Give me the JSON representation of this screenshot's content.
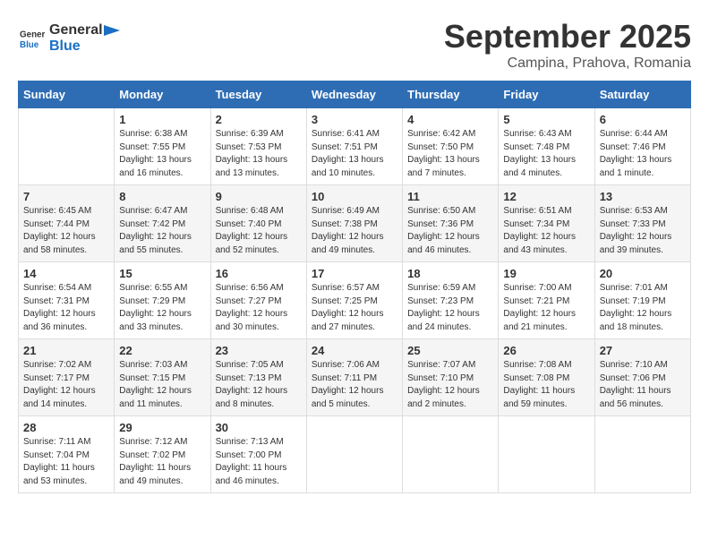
{
  "header": {
    "logo_general": "General",
    "logo_blue": "Blue",
    "month_title": "September 2025",
    "subtitle": "Campina, Prahova, Romania"
  },
  "weekdays": [
    "Sunday",
    "Monday",
    "Tuesday",
    "Wednesday",
    "Thursday",
    "Friday",
    "Saturday"
  ],
  "weeks": [
    [
      {
        "day": "",
        "sunrise": "",
        "sunset": "",
        "daylight": ""
      },
      {
        "day": "1",
        "sunrise": "Sunrise: 6:38 AM",
        "sunset": "Sunset: 7:55 PM",
        "daylight": "Daylight: 13 hours and 16 minutes."
      },
      {
        "day": "2",
        "sunrise": "Sunrise: 6:39 AM",
        "sunset": "Sunset: 7:53 PM",
        "daylight": "Daylight: 13 hours and 13 minutes."
      },
      {
        "day": "3",
        "sunrise": "Sunrise: 6:41 AM",
        "sunset": "Sunset: 7:51 PM",
        "daylight": "Daylight: 13 hours and 10 minutes."
      },
      {
        "day": "4",
        "sunrise": "Sunrise: 6:42 AM",
        "sunset": "Sunset: 7:50 PM",
        "daylight": "Daylight: 13 hours and 7 minutes."
      },
      {
        "day": "5",
        "sunrise": "Sunrise: 6:43 AM",
        "sunset": "Sunset: 7:48 PM",
        "daylight": "Daylight: 13 hours and 4 minutes."
      },
      {
        "day": "6",
        "sunrise": "Sunrise: 6:44 AM",
        "sunset": "Sunset: 7:46 PM",
        "daylight": "Daylight: 13 hours and 1 minute."
      }
    ],
    [
      {
        "day": "7",
        "sunrise": "Sunrise: 6:45 AM",
        "sunset": "Sunset: 7:44 PM",
        "daylight": "Daylight: 12 hours and 58 minutes."
      },
      {
        "day": "8",
        "sunrise": "Sunrise: 6:47 AM",
        "sunset": "Sunset: 7:42 PM",
        "daylight": "Daylight: 12 hours and 55 minutes."
      },
      {
        "day": "9",
        "sunrise": "Sunrise: 6:48 AM",
        "sunset": "Sunset: 7:40 PM",
        "daylight": "Daylight: 12 hours and 52 minutes."
      },
      {
        "day": "10",
        "sunrise": "Sunrise: 6:49 AM",
        "sunset": "Sunset: 7:38 PM",
        "daylight": "Daylight: 12 hours and 49 minutes."
      },
      {
        "day": "11",
        "sunrise": "Sunrise: 6:50 AM",
        "sunset": "Sunset: 7:36 PM",
        "daylight": "Daylight: 12 hours and 46 minutes."
      },
      {
        "day": "12",
        "sunrise": "Sunrise: 6:51 AM",
        "sunset": "Sunset: 7:34 PM",
        "daylight": "Daylight: 12 hours and 43 minutes."
      },
      {
        "day": "13",
        "sunrise": "Sunrise: 6:53 AM",
        "sunset": "Sunset: 7:33 PM",
        "daylight": "Daylight: 12 hours and 39 minutes."
      }
    ],
    [
      {
        "day": "14",
        "sunrise": "Sunrise: 6:54 AM",
        "sunset": "Sunset: 7:31 PM",
        "daylight": "Daylight: 12 hours and 36 minutes."
      },
      {
        "day": "15",
        "sunrise": "Sunrise: 6:55 AM",
        "sunset": "Sunset: 7:29 PM",
        "daylight": "Daylight: 12 hours and 33 minutes."
      },
      {
        "day": "16",
        "sunrise": "Sunrise: 6:56 AM",
        "sunset": "Sunset: 7:27 PM",
        "daylight": "Daylight: 12 hours and 30 minutes."
      },
      {
        "day": "17",
        "sunrise": "Sunrise: 6:57 AM",
        "sunset": "Sunset: 7:25 PM",
        "daylight": "Daylight: 12 hours and 27 minutes."
      },
      {
        "day": "18",
        "sunrise": "Sunrise: 6:59 AM",
        "sunset": "Sunset: 7:23 PM",
        "daylight": "Daylight: 12 hours and 24 minutes."
      },
      {
        "day": "19",
        "sunrise": "Sunrise: 7:00 AM",
        "sunset": "Sunset: 7:21 PM",
        "daylight": "Daylight: 12 hours and 21 minutes."
      },
      {
        "day": "20",
        "sunrise": "Sunrise: 7:01 AM",
        "sunset": "Sunset: 7:19 PM",
        "daylight": "Daylight: 12 hours and 18 minutes."
      }
    ],
    [
      {
        "day": "21",
        "sunrise": "Sunrise: 7:02 AM",
        "sunset": "Sunset: 7:17 PM",
        "daylight": "Daylight: 12 hours and 14 minutes."
      },
      {
        "day": "22",
        "sunrise": "Sunrise: 7:03 AM",
        "sunset": "Sunset: 7:15 PM",
        "daylight": "Daylight: 12 hours and 11 minutes."
      },
      {
        "day": "23",
        "sunrise": "Sunrise: 7:05 AM",
        "sunset": "Sunset: 7:13 PM",
        "daylight": "Daylight: 12 hours and 8 minutes."
      },
      {
        "day": "24",
        "sunrise": "Sunrise: 7:06 AM",
        "sunset": "Sunset: 7:11 PM",
        "daylight": "Daylight: 12 hours and 5 minutes."
      },
      {
        "day": "25",
        "sunrise": "Sunrise: 7:07 AM",
        "sunset": "Sunset: 7:10 PM",
        "daylight": "Daylight: 12 hours and 2 minutes."
      },
      {
        "day": "26",
        "sunrise": "Sunrise: 7:08 AM",
        "sunset": "Sunset: 7:08 PM",
        "daylight": "Daylight: 11 hours and 59 minutes."
      },
      {
        "day": "27",
        "sunrise": "Sunrise: 7:10 AM",
        "sunset": "Sunset: 7:06 PM",
        "daylight": "Daylight: 11 hours and 56 minutes."
      }
    ],
    [
      {
        "day": "28",
        "sunrise": "Sunrise: 7:11 AM",
        "sunset": "Sunset: 7:04 PM",
        "daylight": "Daylight: 11 hours and 53 minutes."
      },
      {
        "day": "29",
        "sunrise": "Sunrise: 7:12 AM",
        "sunset": "Sunset: 7:02 PM",
        "daylight": "Daylight: 11 hours and 49 minutes."
      },
      {
        "day": "30",
        "sunrise": "Sunrise: 7:13 AM",
        "sunset": "Sunset: 7:00 PM",
        "daylight": "Daylight: 11 hours and 46 minutes."
      },
      {
        "day": "",
        "sunrise": "",
        "sunset": "",
        "daylight": ""
      },
      {
        "day": "",
        "sunrise": "",
        "sunset": "",
        "daylight": ""
      },
      {
        "day": "",
        "sunrise": "",
        "sunset": "",
        "daylight": ""
      },
      {
        "day": "",
        "sunrise": "",
        "sunset": "",
        "daylight": ""
      }
    ]
  ]
}
